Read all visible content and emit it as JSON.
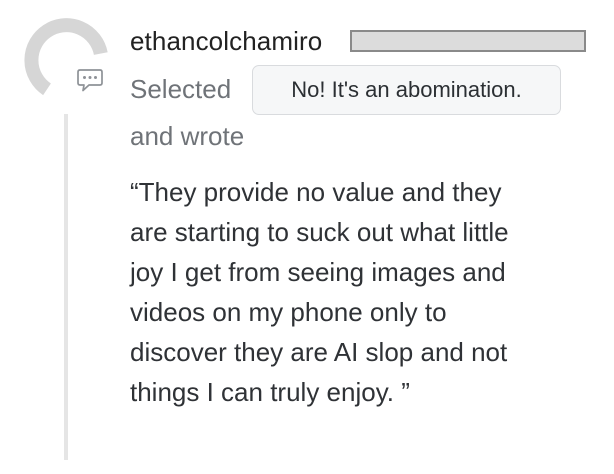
{
  "comment": {
    "username": "ethancolchamiro",
    "selected_label": "Selected",
    "selected_choice": "No! It's an abomination.",
    "wrote_label": "and wrote",
    "quote_lines": [
      "“They provide no value and they",
      "are starting to suck out what little",
      "joy I get from seeing images and",
      "videos on my phone only to",
      "discover they are AI slop and not",
      "things I can truly enjoy. ”"
    ]
  },
  "icons": {
    "avatar": "avatar-placeholder-icon",
    "badge": "comment-icon"
  },
  "colors": {
    "username": "#222222",
    "muted_text": "#6f7378",
    "quote_text": "#2f3236",
    "chip_background": "#f6f7f8",
    "chip_border": "#d9dbde",
    "thread_line": "#e5e5e5",
    "avatar_gray": "#d6d6d6"
  }
}
